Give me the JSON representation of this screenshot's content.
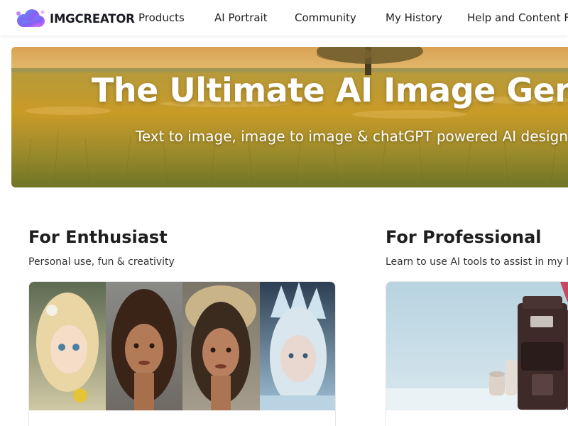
{
  "brand": {
    "name": "IMGCREATOR",
    "colors": {
      "purple": "#8b5cf6",
      "blue": "#5b8def",
      "pink": "#e879f9"
    }
  },
  "nav": {
    "items": [
      {
        "label": "Products"
      },
      {
        "label": "AI Portrait"
      },
      {
        "label": "Community"
      },
      {
        "label": "My History"
      },
      {
        "label": "Help and Content F"
      }
    ]
  },
  "hero": {
    "title": "The Ultimate AI Image Gene",
    "subtitle": "Text to image, image to image & chatGPT powered AI design"
  },
  "sections": [
    {
      "title": "For Enthusiast",
      "subtitle": "Personal use, fun & creativity",
      "card_image": "portrait-collage"
    },
    {
      "title": "For Professional",
      "subtitle": "Learn to use AI tools to assist in my li",
      "card_image": "coffee-machine-product"
    }
  ]
}
